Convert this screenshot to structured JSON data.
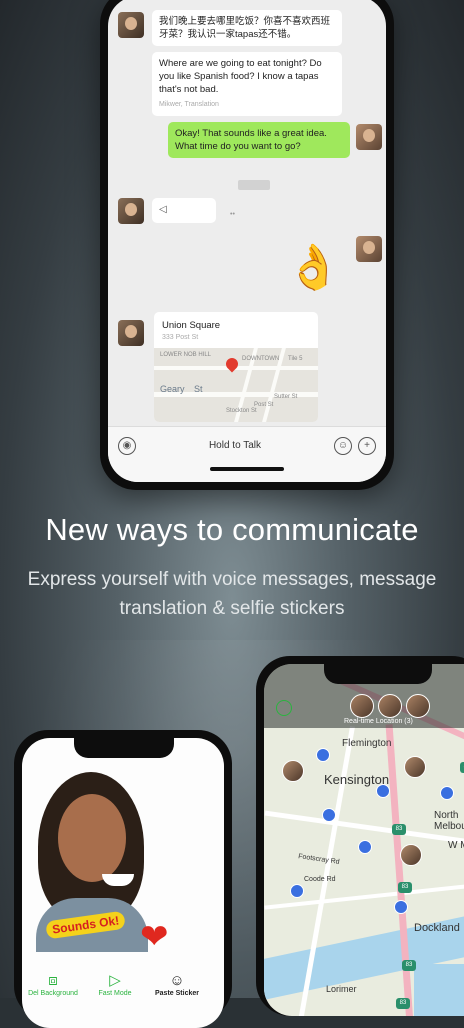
{
  "colors": {
    "wechat_green": "#9fe85c",
    "brand_green": "#2bb33f",
    "chat_background": "#ededed",
    "headline": "#ffffff"
  },
  "chat": {
    "translated_message": {
      "original": "我们晚上要去哪里吃饭？你喜不喜欢西班牙菜？我认识一家tapas还不错。",
      "translation": "Where are we going to eat tonight? Do you like Spanish food? I know a tapas that's not bad.",
      "translation_source": "Mikwer, Translation"
    },
    "reply": "Okay! That sounds like a great idea. What time do you want to go?",
    "voice_icon": "voice-wave-icon",
    "sticker": "ok-hand-sticker",
    "location": {
      "title": "Union Square",
      "subtitle": "333 Post St",
      "map_labels": [
        "LOWER NOB HILL",
        "DOWNTOWN",
        "Geary",
        "St",
        "Post St",
        "Stockton St",
        "Sutter St",
        "Tile 5"
      ]
    },
    "input": {
      "hold_to_talk": "Hold to Talk",
      "voice_toggle_icon": "voice-icon",
      "emoji_icon": "smiley-icon",
      "plus_icon": "plus-icon"
    }
  },
  "promo": {
    "headline": "New ways to communicate",
    "subline": "Express yourself with voice messages, message translation & selfie stickers"
  },
  "sticker_editor": {
    "sticker_text": "Sounds Ok!",
    "tools": [
      {
        "label": "Del Background",
        "icon": "person-frame-icon"
      },
      {
        "label": "Fast Mode",
        "icon": "play-forward-icon"
      },
      {
        "label": "Paste Sticker",
        "icon": "smiley-icon"
      }
    ]
  },
  "location_share": {
    "header_label": "Real-time Location (3)",
    "map_labels": {
      "flemington": "Flemington",
      "kensington": "Kensington",
      "north_melbourne": "North Melbou",
      "west_melbourne": "W Melb",
      "footscray_rd": "Footscray Rd",
      "coode_rd": "Coode Rd",
      "dockland": "Dockland",
      "lorimer": "Lorimer"
    },
    "shields": [
      "83",
      "83",
      "83",
      "83",
      "83"
    ]
  }
}
